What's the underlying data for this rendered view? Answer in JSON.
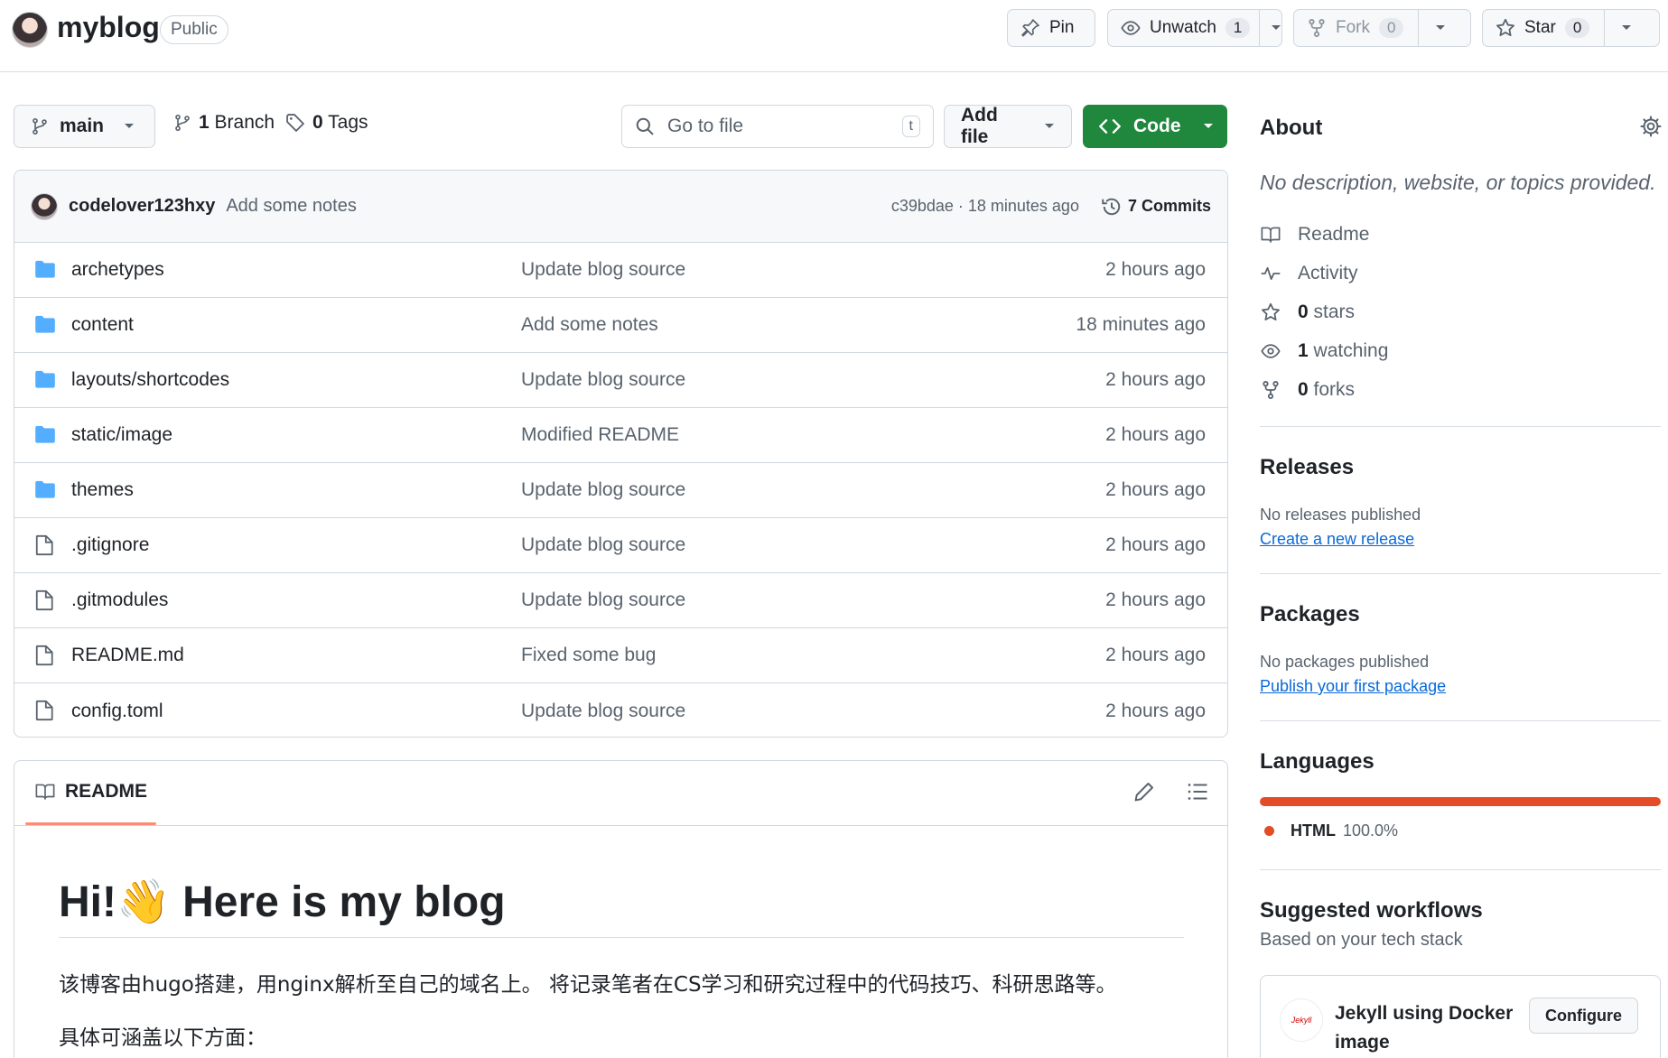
{
  "header": {
    "repo_name": "myblog",
    "visibility": "Public",
    "pin_label": "Pin",
    "unwatch_label": "Unwatch",
    "watch_count": "1",
    "fork_label": "Fork",
    "fork_count": "0",
    "star_label": "Star",
    "star_count": "0"
  },
  "toolbar": {
    "branch": "main",
    "branches_count": "1",
    "branches_label": "Branch",
    "tags_count": "0",
    "tags_label": "Tags",
    "search_placeholder": "Go to file",
    "search_shortcut": "t",
    "add_file_label": "Add file",
    "code_label": "Code"
  },
  "latest_commit": {
    "author": "codelover123hxy",
    "message": "Add some notes",
    "meta": "c39bdae · 18 minutes ago",
    "commits_label": "7 Commits"
  },
  "files": [
    {
      "name": "archetypes",
      "type": "folder",
      "message": "Update blog source",
      "time": "2 hours ago"
    },
    {
      "name": "content",
      "type": "folder",
      "message": "Add some notes",
      "time": "18 minutes ago"
    },
    {
      "name": "layouts/shortcodes",
      "type": "folder",
      "message": "Update blog source",
      "time": "2 hours ago"
    },
    {
      "name": "static/image",
      "type": "folder",
      "message": "Modified README",
      "time": "2 hours ago"
    },
    {
      "name": "themes",
      "type": "folder",
      "message": "Update blog source",
      "time": "2 hours ago"
    },
    {
      "name": ".gitignore",
      "type": "file",
      "message": "Update blog source",
      "time": "2 hours ago"
    },
    {
      "name": ".gitmodules",
      "type": "file",
      "message": "Update blog source",
      "time": "2 hours ago"
    },
    {
      "name": "README.md",
      "type": "file",
      "message": "Fixed some bug",
      "time": "2 hours ago"
    },
    {
      "name": "config.toml",
      "type": "file",
      "message": "Update blog source",
      "time": "2 hours ago"
    }
  ],
  "readme": {
    "tab_label": "README",
    "heading": "Hi!👋 Here is my blog",
    "p1": "该博客由hugo搭建，用nginx解析至自己的域名上。 将记录笔者在CS学习和研究过程中的代码技巧、科研思路等。",
    "p2": "具体可涵盖以下方面："
  },
  "about": {
    "title": "About",
    "description": "No description, website, or topics provided.",
    "readme": "Readme",
    "activity": "Activity",
    "stars_count": "0",
    "stars_label": "stars",
    "watching_count": "1",
    "watching_label": "watching",
    "forks_count": "0",
    "forks_label": "forks"
  },
  "releases": {
    "title": "Releases",
    "status": "No releases published",
    "link": "Create a new release"
  },
  "packages": {
    "title": "Packages",
    "status": "No packages published",
    "link": "Publish your first package"
  },
  "languages": {
    "title": "Languages",
    "name": "HTML",
    "percent": "100.0%",
    "html_share": 1.0,
    "color": "#e34c26"
  },
  "workflows": {
    "title": "Suggested workflows",
    "subtitle": "Based on your tech stack",
    "item_name": "Jekyll using Docker image",
    "configure_label": "Configure"
  },
  "colors": {
    "accent_green": "#1f883d",
    "link_blue": "#0969da",
    "folder_blue": "#54aeff"
  }
}
